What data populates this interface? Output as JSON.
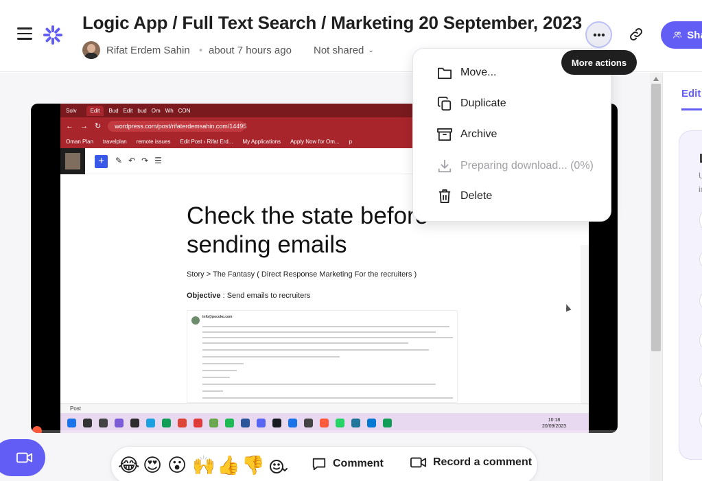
{
  "header": {
    "title": "Logic App / Full Text Search / Marketing 20 September, 2023",
    "author": "Rifat Erdem Sahin",
    "separator": "•",
    "time": "about 7 hours ago",
    "sharing": "Not shared",
    "share_label": "Share"
  },
  "tooltip": {
    "text": "More actions"
  },
  "menu": {
    "items": [
      {
        "label": "Move...",
        "icon": "folder-icon"
      },
      {
        "label": "Duplicate",
        "icon": "copy-icon"
      },
      {
        "label": "Archive",
        "icon": "archive-icon"
      },
      {
        "label": "Preparing download... (0%)",
        "icon": "download-icon",
        "disabled": true
      },
      {
        "label": "Delete",
        "icon": "trash-icon"
      }
    ]
  },
  "side_panel": {
    "tab": "Edit",
    "letter": "L",
    "sub1": "U",
    "sub2": "in"
  },
  "video": {
    "browser_tabs": [
      "Solv",
      "",
      "Edit",
      "Bud",
      "Edit",
      "bud",
      "Om",
      "Wh",
      "CON"
    ],
    "url": "wordpress.com/post/rifaterdemsahin.com/14495",
    "bookmarks": [
      "Oman Plan",
      "travelplan",
      "remote issues",
      "Edit Post ‹ Rifat Erd...",
      "My Applications",
      "Apply Now for Om...",
      "p"
    ],
    "doc_title": "Check the state before sending emails",
    "story": "Story > The Fantasy ( Direct Response Marketing For the recruiters )",
    "objective_label": "Objective",
    "objective_text": " : Send emails to recruiters",
    "email_from": "info@pocoko.com",
    "post_label": "Post",
    "clock_time": "10:18",
    "clock_date": "20/09/2023"
  },
  "bottom": {
    "emojis": [
      "😂",
      "😍",
      "😮",
      "🙌",
      "👍",
      "👎"
    ],
    "comment_label": "Comment",
    "record_label": "Record a comment"
  },
  "colors": {
    "accent": "#625df5",
    "tooltip_bg": "#1f1f1f",
    "browser_red": "#a8252b"
  }
}
